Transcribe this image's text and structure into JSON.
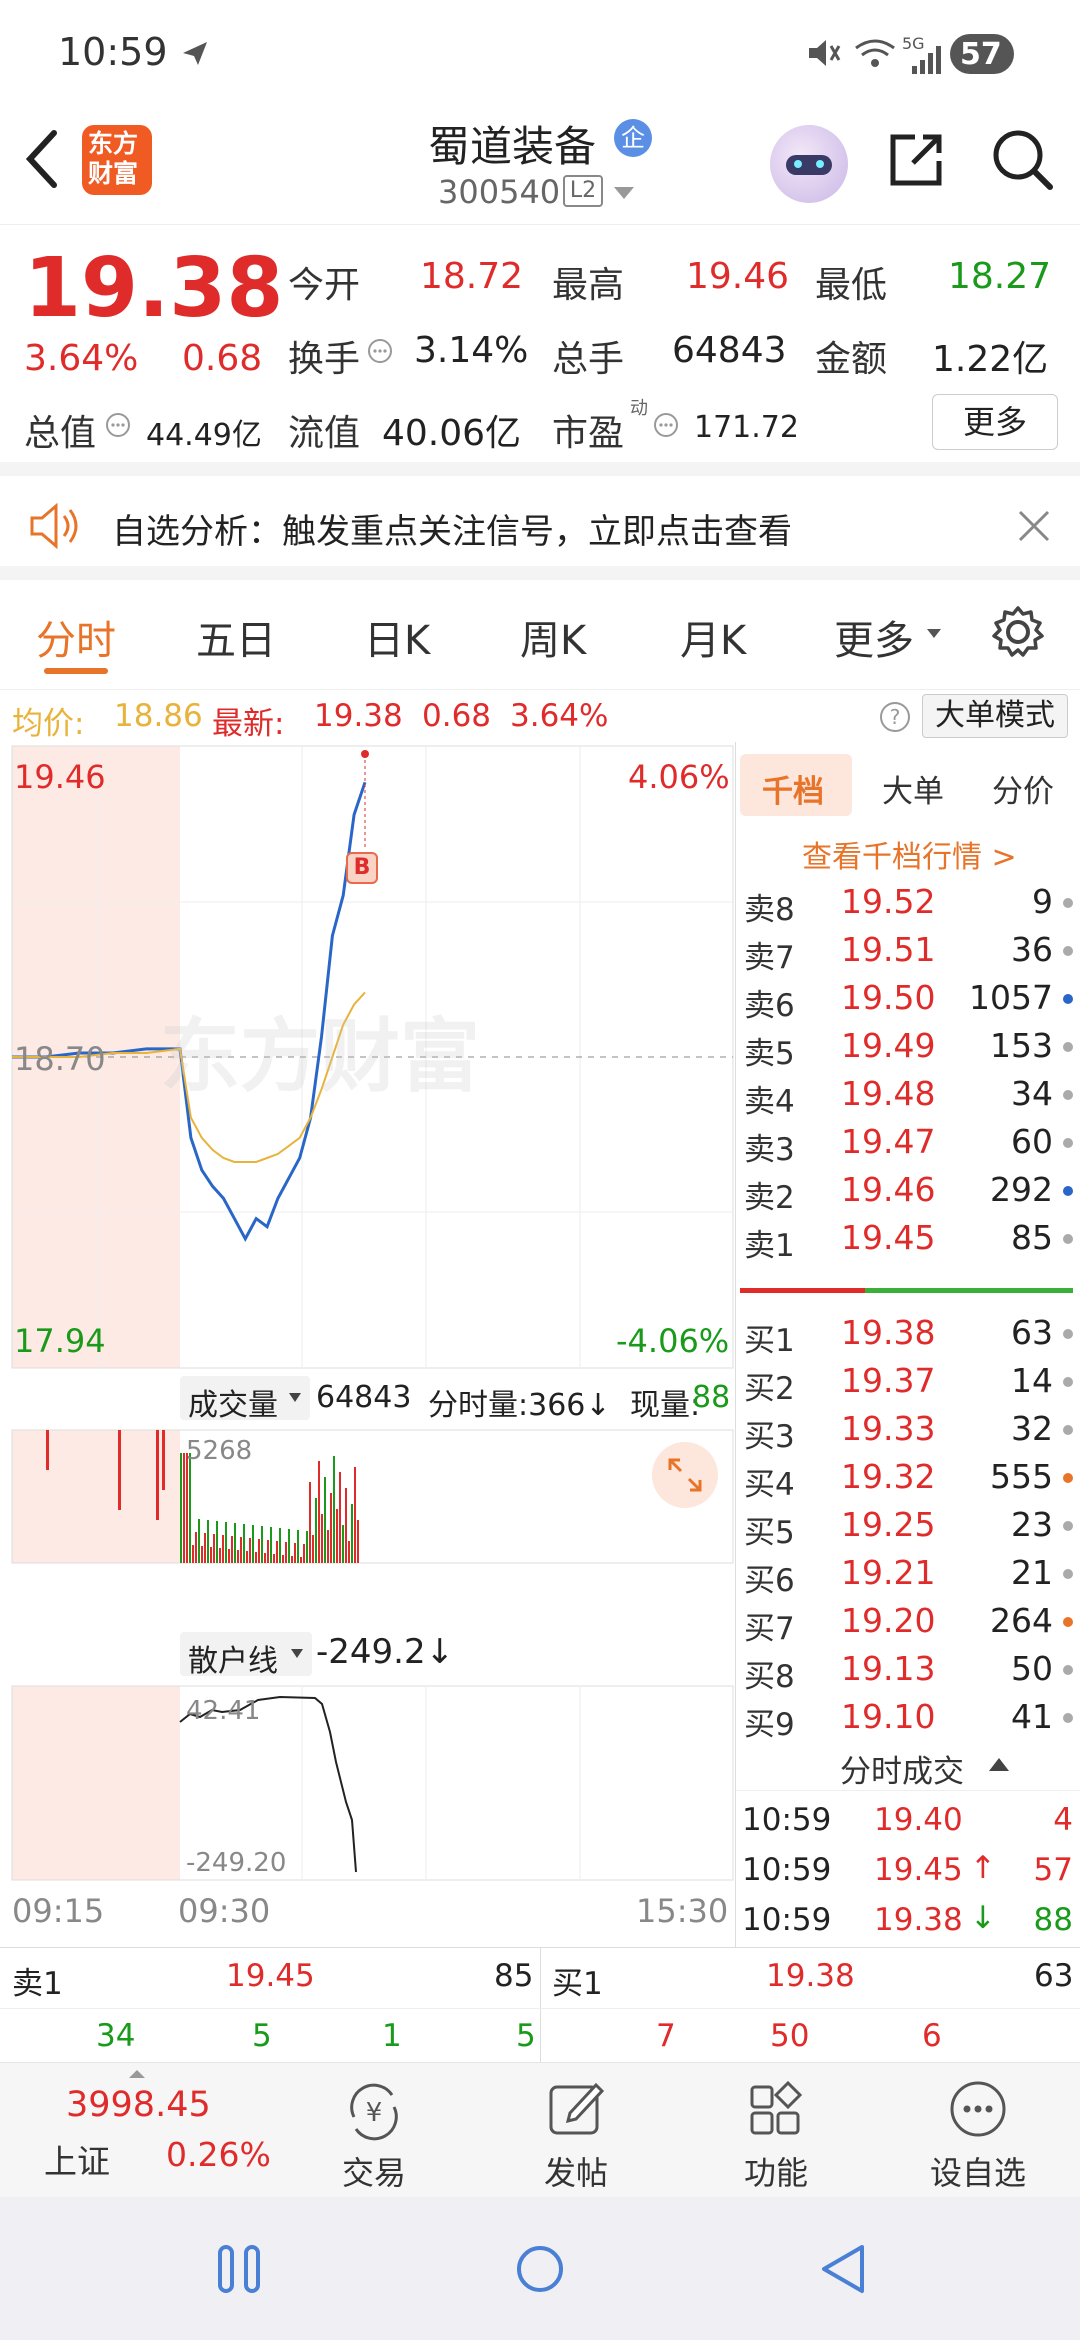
{
  "status": {
    "time": "10:59",
    "battery": "57",
    "net": "5G"
  },
  "header": {
    "app_logo": "东方\n财富",
    "logo_line1": "东方",
    "logo_line2": "财富",
    "stock_name": "蜀道装备",
    "badge": "企",
    "code": "300540",
    "level": "L2"
  },
  "quote": {
    "price": "19.38",
    "change_pct": "3.64%",
    "change": "0.68",
    "open_label": "今开",
    "open": "18.72",
    "high_label": "最高",
    "high": "19.46",
    "low_label": "最低",
    "low": "18.27",
    "turnover_label": "换手",
    "turnover": "3.14%",
    "volume_label": "总手",
    "volume": "64843",
    "amount_label": "金额",
    "amount": "1.22亿",
    "mktcap_label": "总值",
    "mktcap": "44.49亿",
    "float_label": "流值",
    "float": "40.06亿",
    "pe_label": "市盈",
    "pe_sup": "动",
    "pe": "171.72",
    "more": "更多"
  },
  "banner": {
    "text": "自选分析：触发重点关注信号，立即点击查看"
  },
  "tabs": [
    "分时",
    "五日",
    "日K",
    "周K",
    "月K",
    "更多"
  ],
  "active_tab": 0,
  "avgline": {
    "avg_label": "均价:",
    "avg": "18.86",
    "latest_label": "最新:",
    "latest": "19.38",
    "chg": "0.68",
    "pct": "3.64%",
    "mode": "大单模式"
  },
  "chart": {
    "top_price": "19.46",
    "top_pct": "4.06%",
    "mid_price": "18.70",
    "bottom_price": "17.94",
    "bottom_pct": "-4.06%",
    "watermark": "东方财富",
    "b_marker": "B",
    "vol_selector": "成交量",
    "vol_total": "64843",
    "vol_min_label": "分时量:366↓",
    "vol_now_label": "现量:",
    "vol_now": "88",
    "vol_max": "5268",
    "retail_selector": "散户线",
    "retail_value": "-249.2↓",
    "retail_top": "42.41",
    "retail_bottom": "-249.20",
    "time_start": "09:15",
    "time_open": "09:30",
    "time_end": "15:30"
  },
  "chart_data": {
    "type": "line",
    "title": "",
    "xlabel": "",
    "ylabel": "",
    "ylim": [
      17.94,
      19.46
    ],
    "x_ticks": [
      "09:15",
      "09:30",
      "15:30"
    ],
    "series": [
      {
        "name": "",
        "color": "#2a66c8",
        "values": [
          18.7,
          18.7,
          18.71,
          18.71,
          18.72,
          18.72,
          18.5,
          18.42,
          18.38,
          18.35,
          18.3,
          18.25,
          18.3,
          18.28,
          18.35,
          18.4,
          18.45,
          18.55,
          18.75,
          19.0,
          19.1,
          19.3,
          19.38
        ]
      },
      {
        "name": "",
        "color": "#e8b33a",
        "values": [
          18.7,
          18.7,
          18.7,
          18.71,
          18.71,
          18.72,
          18.55,
          18.5,
          18.47,
          18.45,
          18.44,
          18.44,
          18.44,
          18.45,
          18.46,
          18.48,
          18.5,
          18.55,
          18.62,
          18.7,
          18.78,
          18.83,
          18.86
        ]
      }
    ]
  },
  "book": {
    "tabs": [
      "千档",
      "大单",
      "分价"
    ],
    "link": "查看千档行情 >",
    "asks": [
      {
        "label": "卖8",
        "price": "19.52",
        "vol": "9",
        "dot": "#aaaaaa"
      },
      {
        "label": "卖7",
        "price": "19.51",
        "vol": "36",
        "dot": "#aaaaaa"
      },
      {
        "label": "卖6",
        "price": "19.50",
        "vol": "1057",
        "dot": "#2a66c8"
      },
      {
        "label": "卖5",
        "price": "19.49",
        "vol": "153",
        "dot": "#aaaaaa"
      },
      {
        "label": "卖4",
        "price": "19.48",
        "vol": "34",
        "dot": "#aaaaaa"
      },
      {
        "label": "卖3",
        "price": "19.47",
        "vol": "60",
        "dot": "#aaaaaa"
      },
      {
        "label": "卖2",
        "price": "19.46",
        "vol": "292",
        "dot": "#2a66c8"
      },
      {
        "label": "卖1",
        "price": "19.45",
        "vol": "85",
        "dot": "#aaaaaa"
      }
    ],
    "bids": [
      {
        "label": "买1",
        "price": "19.38",
        "vol": "63",
        "dot": "#aaaaaa"
      },
      {
        "label": "买2",
        "price": "19.37",
        "vol": "14",
        "dot": "#aaaaaa"
      },
      {
        "label": "买3",
        "price": "19.33",
        "vol": "32",
        "dot": "#aaaaaa"
      },
      {
        "label": "买4",
        "price": "19.32",
        "vol": "555",
        "dot": "#e8742a"
      },
      {
        "label": "买5",
        "price": "19.25",
        "vol": "23",
        "dot": "#aaaaaa"
      },
      {
        "label": "买6",
        "price": "19.21",
        "vol": "21",
        "dot": "#aaaaaa"
      },
      {
        "label": "买7",
        "price": "19.20",
        "vol": "264",
        "dot": "#e8742a"
      },
      {
        "label": "买8",
        "price": "19.13",
        "vol": "50",
        "dot": "#aaaaaa"
      },
      {
        "label": "买9",
        "price": "19.10",
        "vol": "41",
        "dot": "#aaaaaa"
      }
    ],
    "trades_title": "分时成交",
    "trades": [
      {
        "time": "10:59",
        "price": "19.40",
        "vol": "4",
        "arrow": ""
      },
      {
        "time": "10:59",
        "price": "19.45",
        "vol": "57",
        "arrow": "↑"
      },
      {
        "time": "10:59",
        "price": "19.38",
        "vol": "88",
        "arrow": "↓"
      }
    ]
  },
  "bottom": {
    "sell_label": "卖1",
    "sell_price": "19.45",
    "sell_vol": "85",
    "buy_label": "买1",
    "buy_price": "19.38",
    "buy_vol": "63",
    "sell_queue": [
      "34",
      "5",
      "1",
      "5"
    ],
    "buy_queue": [
      "7",
      "50",
      "6"
    ]
  },
  "nav": {
    "index_value": "3998.45",
    "index_name": "上证",
    "index_pct": "0.26%",
    "items": [
      "交易",
      "发帖",
      "功能",
      "设自选"
    ]
  }
}
